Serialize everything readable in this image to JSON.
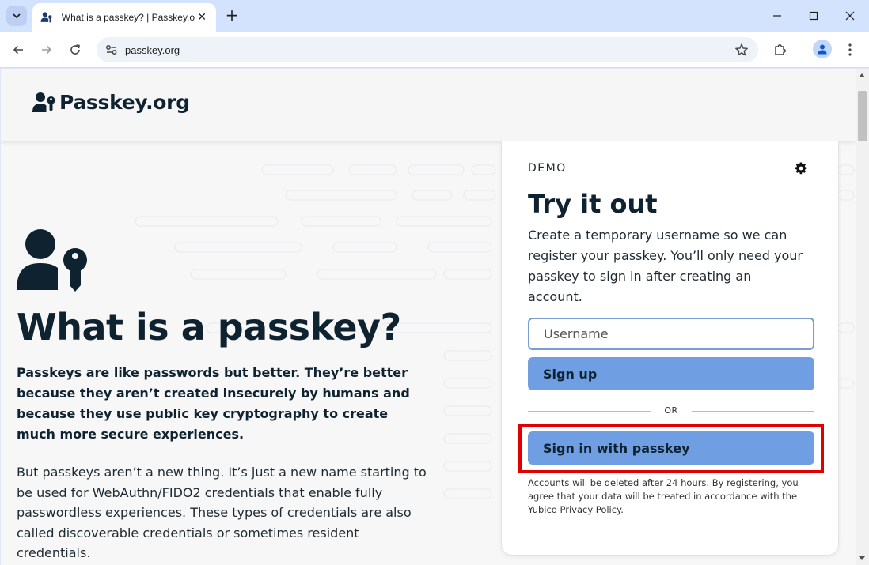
{
  "browser": {
    "tab_title": "What is a passkey? | Passkey.org",
    "tab_close": "✕",
    "new_tab": "+",
    "url": "passkey.org"
  },
  "header": {
    "logo_text": "Passkey.org"
  },
  "hero": {
    "title": "What is a passkey?",
    "lead": "Passkeys are like passwords but better. They’re better because they aren’t created insecurely by humans and because they use public key cryptography to create much more secure experiences.",
    "body": "But passkeys aren’t a new thing. It’s just a new name starting to be used for WebAuthn/FIDO2 credentials that enable fully passwordless experiences. These types of credentials are also called discoverable credentials or sometimes resident credentials."
  },
  "demo": {
    "label": "DEMO",
    "title": "Try it out",
    "description": "Create a temporary username so we can register your passkey. You’ll only need your passkey to sign in after creating an account.",
    "username_placeholder": "Username",
    "signup_label": "Sign up",
    "or_label": "OR",
    "passkey_label": "Sign in with passkey",
    "fine_print": "Accounts will be deleted after 24 hours. By registering, you agree that your data will be treated in accordance with the",
    "privacy_link": "Yubico Privacy Policy",
    "fine_print_end": "."
  },
  "colors": {
    "accent_button": "#6f9ee2",
    "highlight": "#e00000",
    "text_dark": "#0f2230"
  }
}
